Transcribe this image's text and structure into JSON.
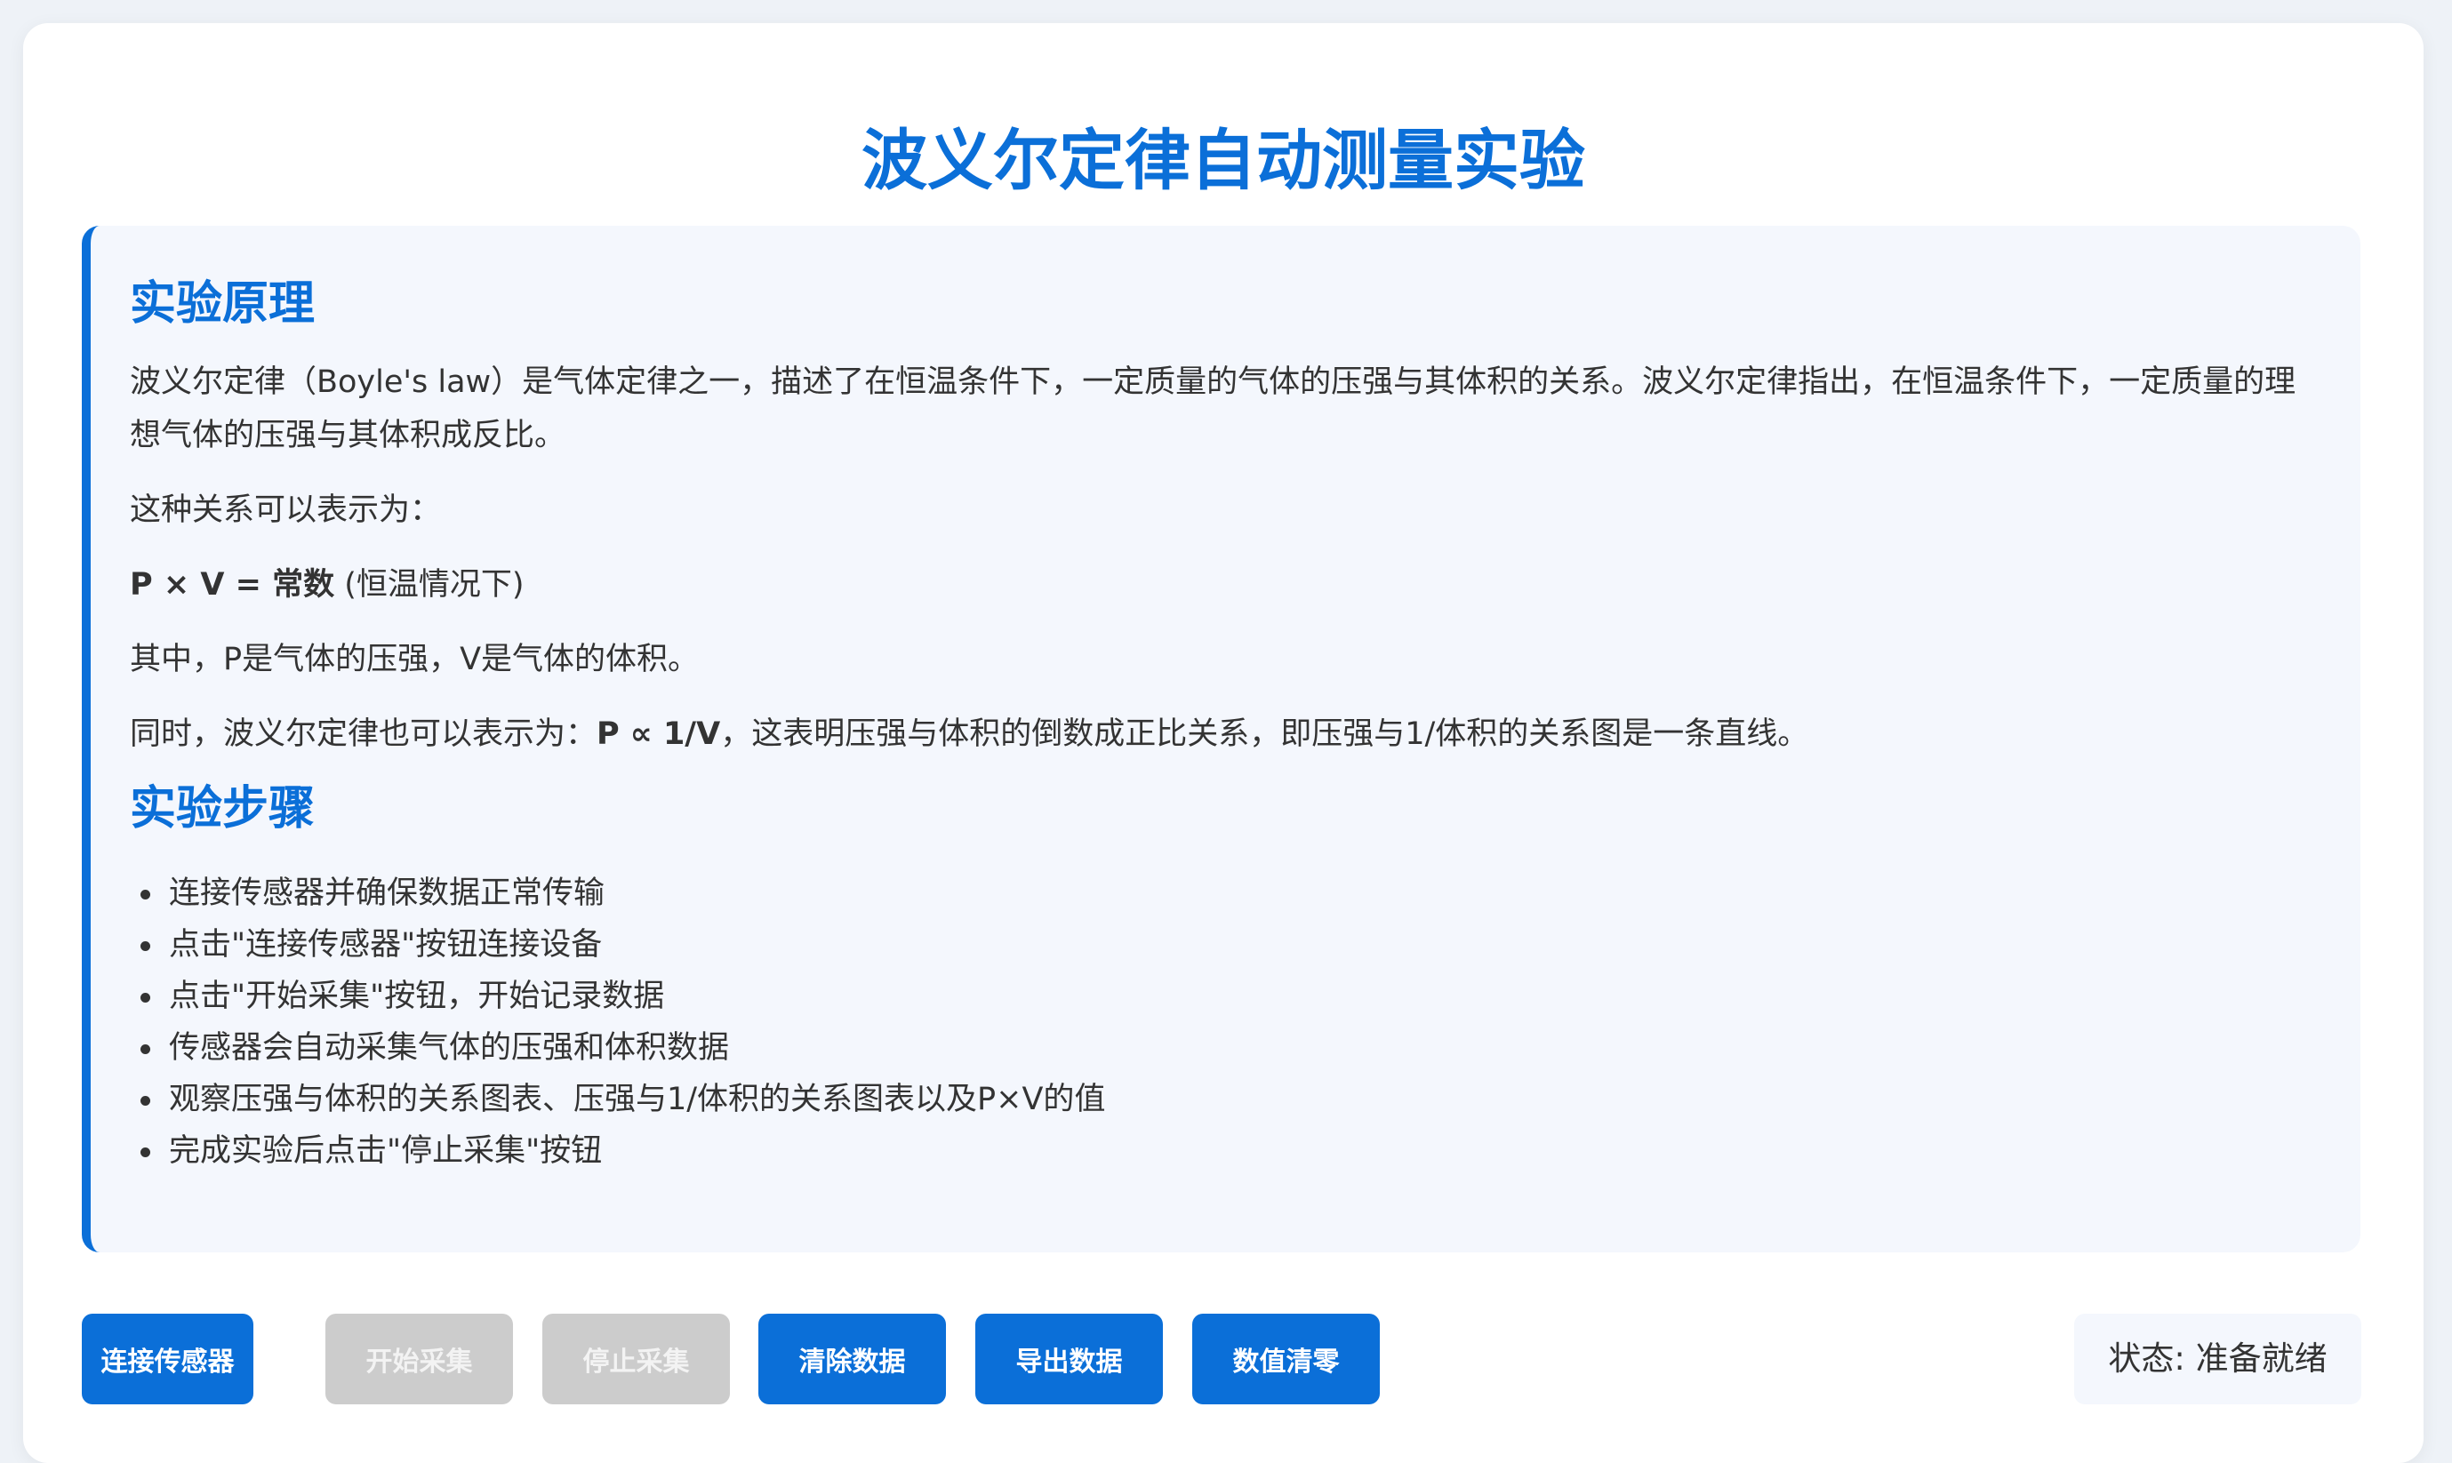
{
  "page": {
    "title": "波义尔定律自动测量实验"
  },
  "principle": {
    "heading": "实验原理",
    "paragraph1": "波义尔定律（Boyle's law）是气体定律之一，描述了在恒温条件下，一定质量的气体的压强与其体积的关系。波义尔定律指出，在恒温条件下，一定质量的理想气体的压强与其体积成反比。",
    "paragraph2": "这种关系可以表示为：",
    "formula_bold": "P × V = 常数",
    "formula_note": " (恒温情况下)",
    "paragraph4": "其中，P是气体的压强，V是气体的体积。",
    "paragraph5_prefix": "同时，波义尔定律也可以表示为：",
    "paragraph5_bold": "P ∝ 1/V",
    "paragraph5_suffix": "，这表明压强与体积的倒数成正比关系，即压强与1/体积的关系图是一条直线。"
  },
  "steps": {
    "heading": "实验步骤",
    "items": [
      "连接传感器并确保数据正常传输",
      "点击\"连接传感器\"按钮连接设备",
      "点击\"开始采集\"按钮，开始记录数据",
      "传感器会自动采集气体的压强和体积数据",
      "观察压强与体积的关系图表、压强与1/体积的关系图表以及P×V的值",
      "完成实验后点击\"停止采集\"按钮"
    ]
  },
  "controls": {
    "connect_label": "连接传感器",
    "start_label": "开始采集",
    "stop_label": "停止采集",
    "clear_label": "清除数据",
    "export_label": "导出数据",
    "zero_label": "数值清零",
    "start_enabled": false,
    "stop_enabled": false
  },
  "status": {
    "text": "状态: 准备就绪"
  },
  "colors": {
    "accent": "#0b6fd8",
    "disabled": "#cccccc",
    "panel_bg": "#f4f7fd"
  }
}
